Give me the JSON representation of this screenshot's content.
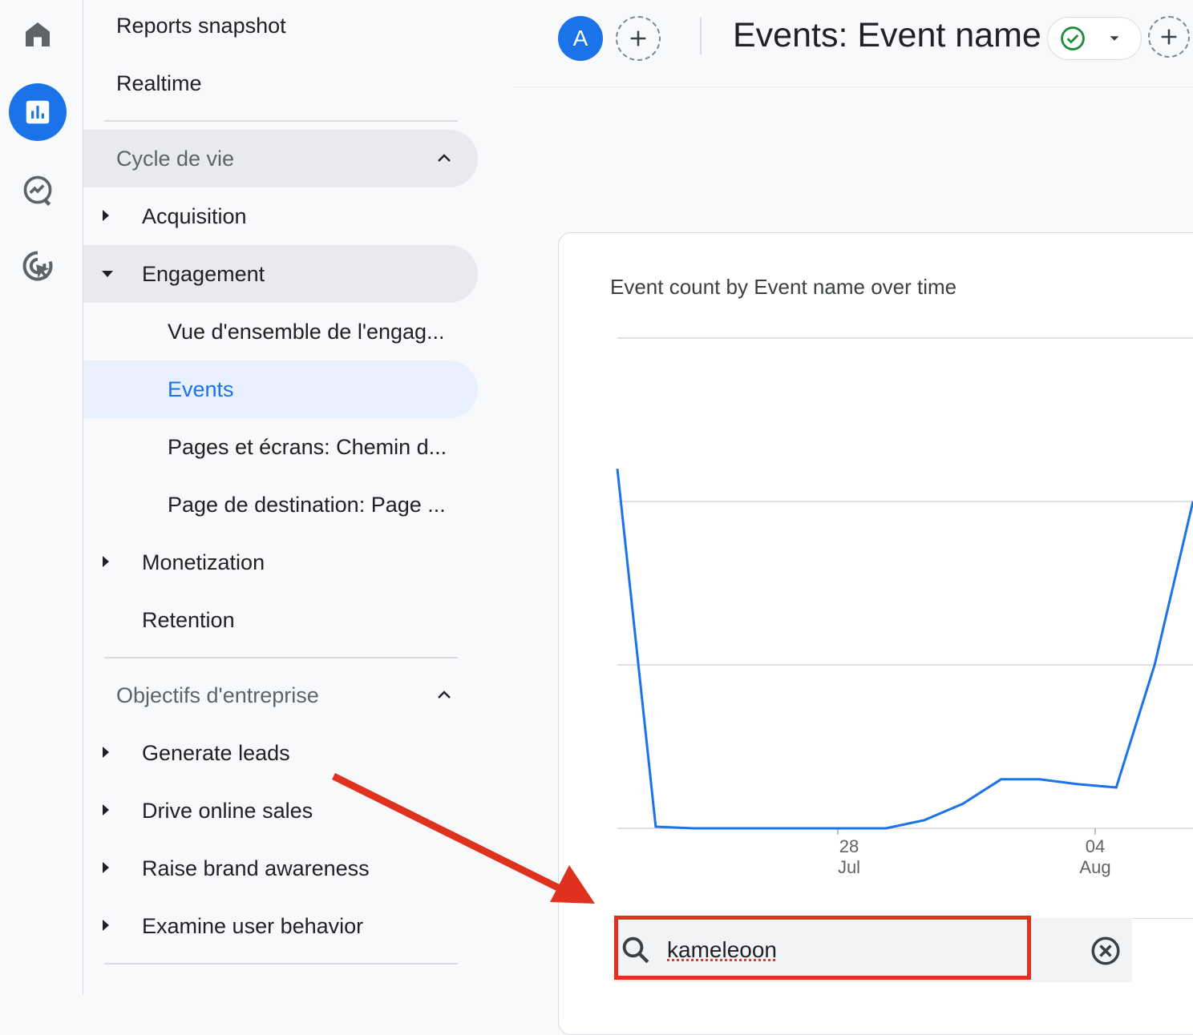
{
  "header": {
    "avatar_letter": "A",
    "page_title": "Events: Event name"
  },
  "nav": {
    "reports_snapshot": "Reports snapshot",
    "realtime": "Realtime",
    "lifecycle": {
      "label": "Cycle de vie",
      "items": {
        "acquisition": "Acquisition",
        "engagement": "Engagement",
        "engagement_overview": "Vue d'ensemble de l'engag...",
        "events": "Events",
        "pages_screens": "Pages et écrans: Chemin d...",
        "landing_page": "Page de destination: Page ...",
        "monetization": "Monetization",
        "retention": "Retention"
      }
    },
    "business_objectives": {
      "label": "Objectifs d'entreprise",
      "items": {
        "generate_leads": "Generate leads",
        "drive_online_sales": "Drive online sales",
        "raise_brand_awareness": "Raise brand awareness",
        "examine_user_behavior": "Examine user behavior"
      }
    }
  },
  "colors": {
    "accent": "#1a73e8",
    "annotation": "#e0301e",
    "selected_bg": "#e8f0fe",
    "status_ok": "#1e8e3e"
  },
  "chart_data": {
    "type": "line",
    "title": "Event count by Event name over time",
    "x_ticks": [
      {
        "day": "28",
        "month": "Jul"
      },
      {
        "day": "04",
        "month": "Aug"
      }
    ],
    "series": [
      {
        "values": [
          2.2,
          0.01,
          0.0,
          0.0,
          0.0,
          0.0,
          0.0,
          0.0,
          0.05,
          0.15,
          0.3,
          0.3,
          0.27,
          0.25,
          1.0,
          2.0
        ]
      }
    ],
    "ylim": [
      0,
      3
    ],
    "gridlines": true
  },
  "search": {
    "value": "kameleoon"
  }
}
